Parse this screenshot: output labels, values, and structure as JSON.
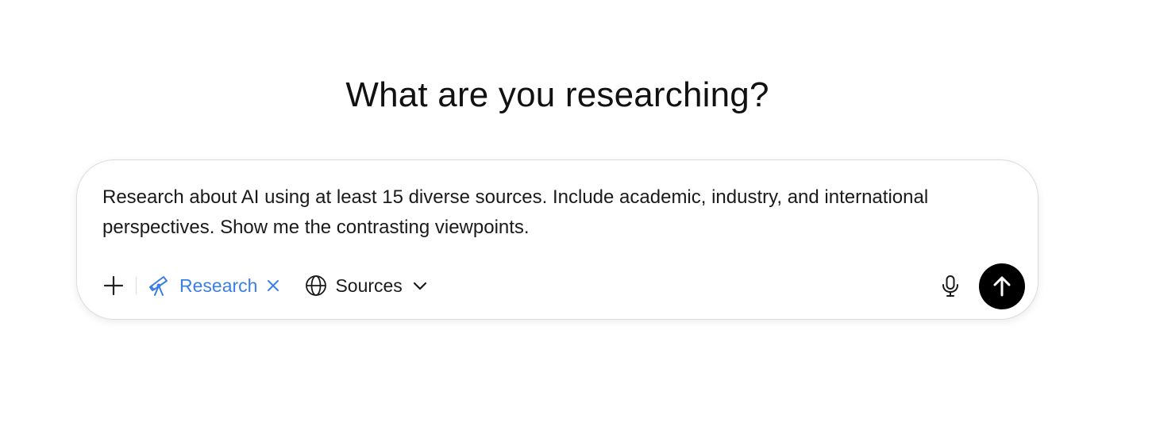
{
  "heading": "What are you researching?",
  "composer": {
    "prompt_text": "Research about AI using at least 15 diverse sources. Include academic, industry, and international perspectives. Show me the contrasting viewpoints.",
    "add_icon": "plus-icon",
    "research_chip": {
      "icon": "telescope-icon",
      "label": "Research",
      "remove_icon": "close-icon",
      "color": "#3b7fe6"
    },
    "sources_chip": {
      "icon": "globe-icon",
      "label": "Sources",
      "chevron_icon": "chevron-down-icon"
    },
    "mic_icon": "microphone-icon",
    "send_icon": "arrow-up-icon",
    "send_button_color": "#000000"
  }
}
